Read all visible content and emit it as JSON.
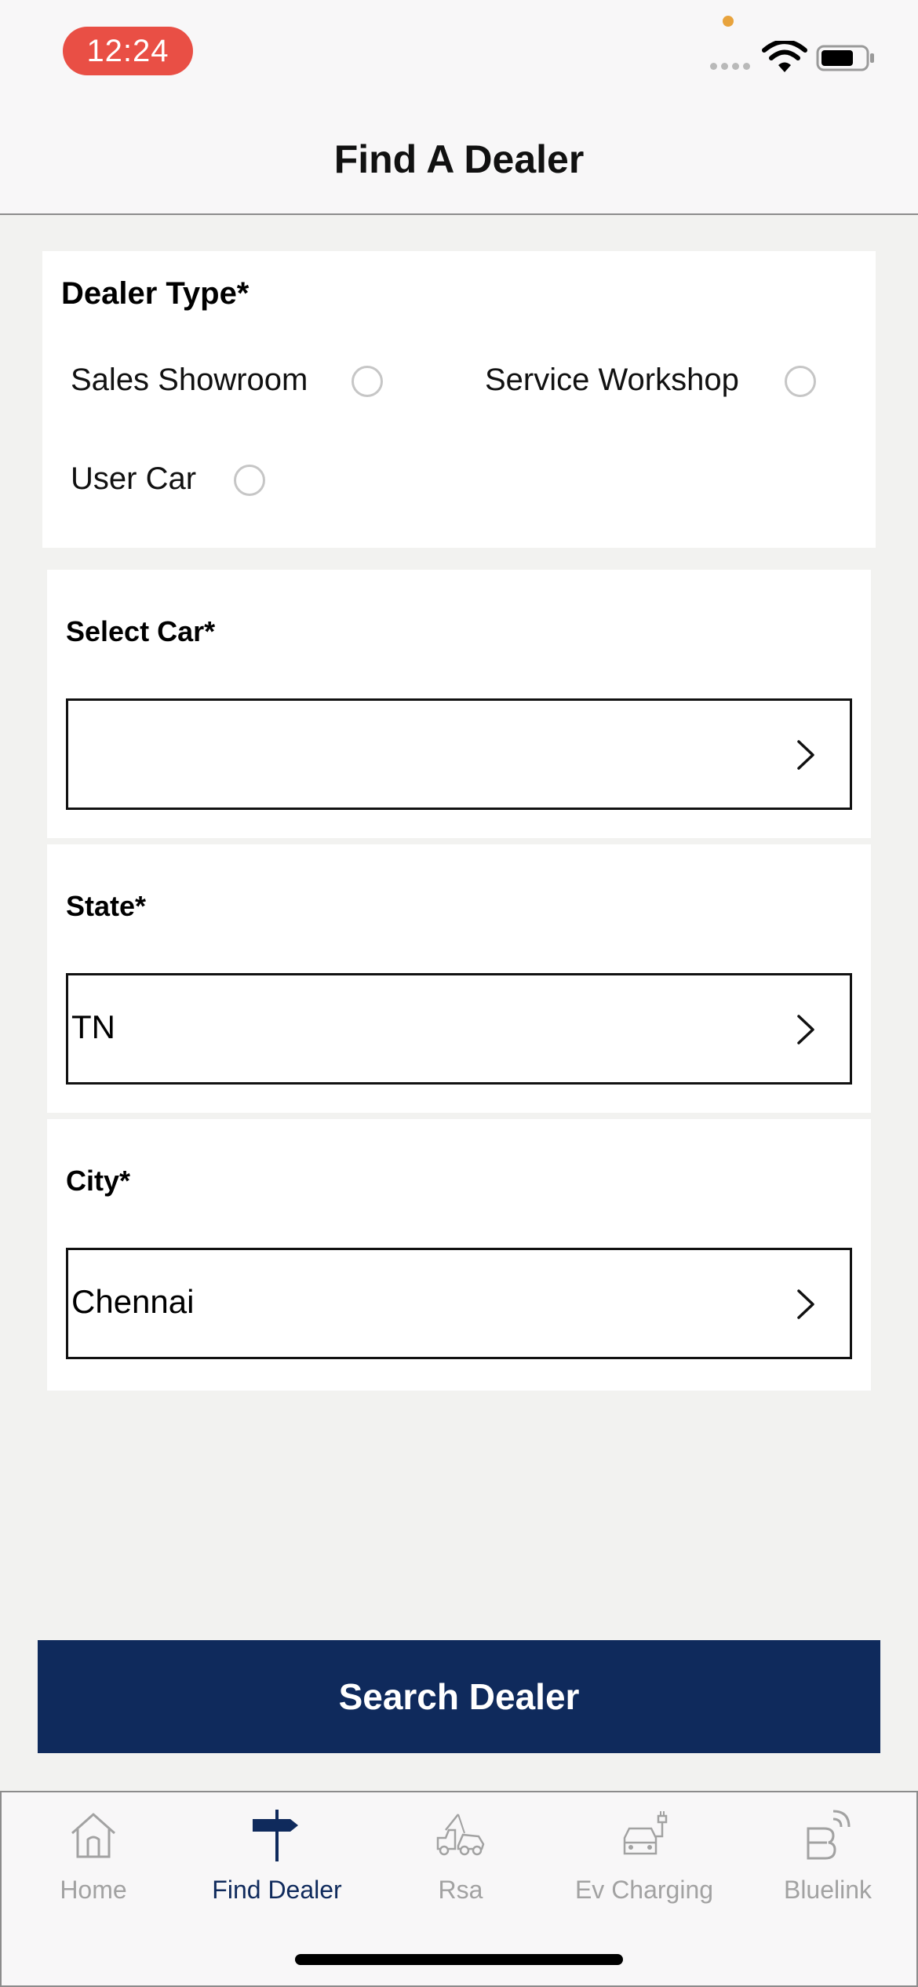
{
  "status_bar": {
    "time": "12:24",
    "time_pill_color": "#e94f45",
    "icons": [
      "cellular-signal-icon",
      "wifi-icon",
      "battery-icon"
    ]
  },
  "header": {
    "title": "Find A Dealer"
  },
  "dealer_type": {
    "title": "Dealer Type*",
    "options": [
      {
        "label": "Sales Showroom",
        "selected": false
      },
      {
        "label": "Service Workshop",
        "selected": false
      },
      {
        "label": "User Car",
        "selected": false
      }
    ]
  },
  "fields": {
    "car": {
      "label": "Select Car*",
      "value": ""
    },
    "state": {
      "label": "State*",
      "value": "TN"
    },
    "city": {
      "label": "City*",
      "value": "Chennai"
    }
  },
  "search_button": {
    "label": "Search Dealer",
    "color": "#0f2a5c"
  },
  "tab_bar": {
    "active_color": "#0f2a5c",
    "inactive_color": "#a2a2a2",
    "tabs": [
      {
        "label": "Home",
        "icon": "home-icon",
        "active": false
      },
      {
        "label": "Find Dealer",
        "icon": "signpost-icon",
        "active": true
      },
      {
        "label": "Rsa",
        "icon": "tow-truck-icon",
        "active": false
      },
      {
        "label": "Ev Charging",
        "icon": "ev-charging-icon",
        "active": false
      },
      {
        "label": "Bluelink",
        "icon": "bluelink-icon",
        "active": false
      }
    ]
  }
}
